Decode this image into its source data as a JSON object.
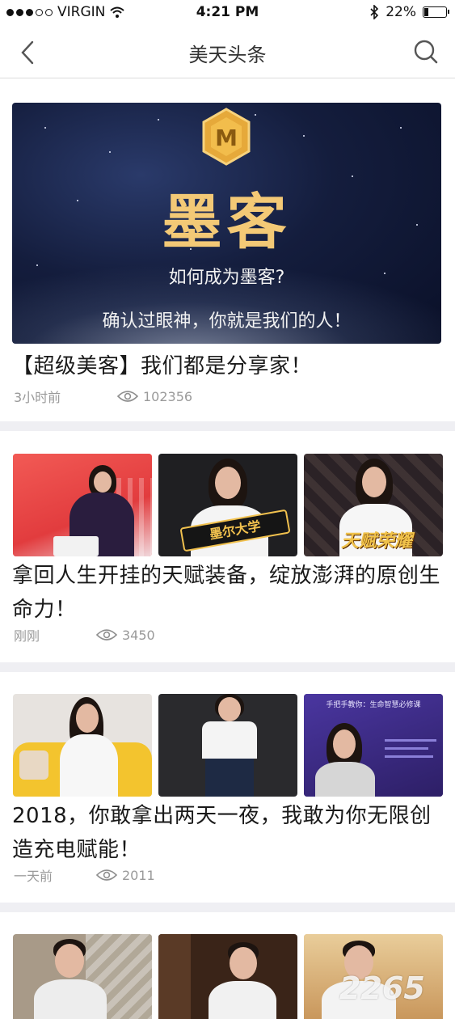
{
  "status_bar": {
    "carrier": "VIRGIN",
    "time": "4:21 PM",
    "battery": "22%",
    "battery_level": 0.22
  },
  "nav": {
    "title": "美天头条"
  },
  "articles": [
    {
      "banner": {
        "logo_letter": "M",
        "title": "墨客",
        "subtitle": "如何成为墨客?",
        "slogan": "确认过眼神，你就是我们的人！"
      },
      "headline": "【超级美客】我们都是分享家！",
      "time": "3小时前",
      "views": "102356"
    },
    {
      "headline": "拿回人生开挂的天赋装备，绽放澎湃的原创生命力！",
      "time": "刚刚",
      "views": "3450",
      "thumb_captions": [
        "墨尔大学",
        "天赋荣耀"
      ]
    },
    {
      "headline": "2018，你敢拿出两天一夜，我敢为你无限创造充电赋能！",
      "time": "一天前",
      "views": "2011",
      "thumb_captions": [
        "手把手教你：生命智慧必修课"
      ]
    }
  ],
  "watermark": "2265"
}
